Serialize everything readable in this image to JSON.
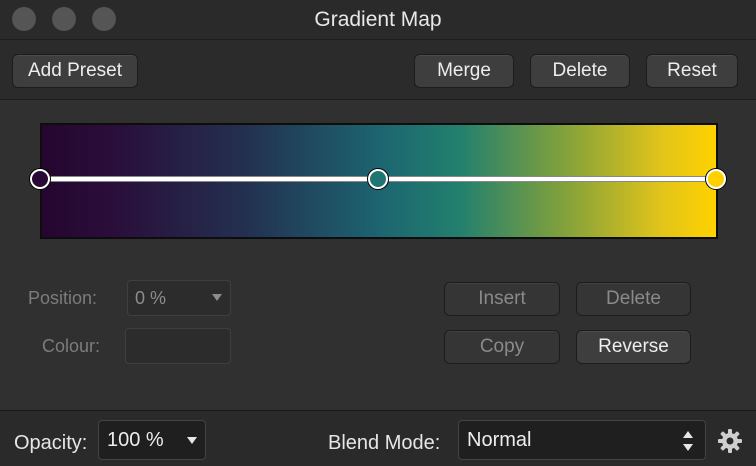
{
  "window": {
    "title": "Gradient Map"
  },
  "toolbar": {
    "add_preset": "Add Preset",
    "merge": "Merge",
    "delete": "Delete",
    "reset": "Reset"
  },
  "gradient": {
    "stops": [
      {
        "position": 0,
        "color": "#2a0a35"
      },
      {
        "position": 50,
        "color": "#1f7572"
      },
      {
        "position": 100,
        "color": "#ffd000"
      }
    ]
  },
  "editor": {
    "position_label": "Position:",
    "position_value": "0 %",
    "colour_label": "Colour:",
    "insert": "Insert",
    "delete": "Delete",
    "copy": "Copy",
    "reverse": "Reverse"
  },
  "footer": {
    "opacity_label": "Opacity:",
    "opacity_value": "100 %",
    "blend_label": "Blend Mode:",
    "blend_value": "Normal",
    "settings_icon": "gear-icon"
  }
}
